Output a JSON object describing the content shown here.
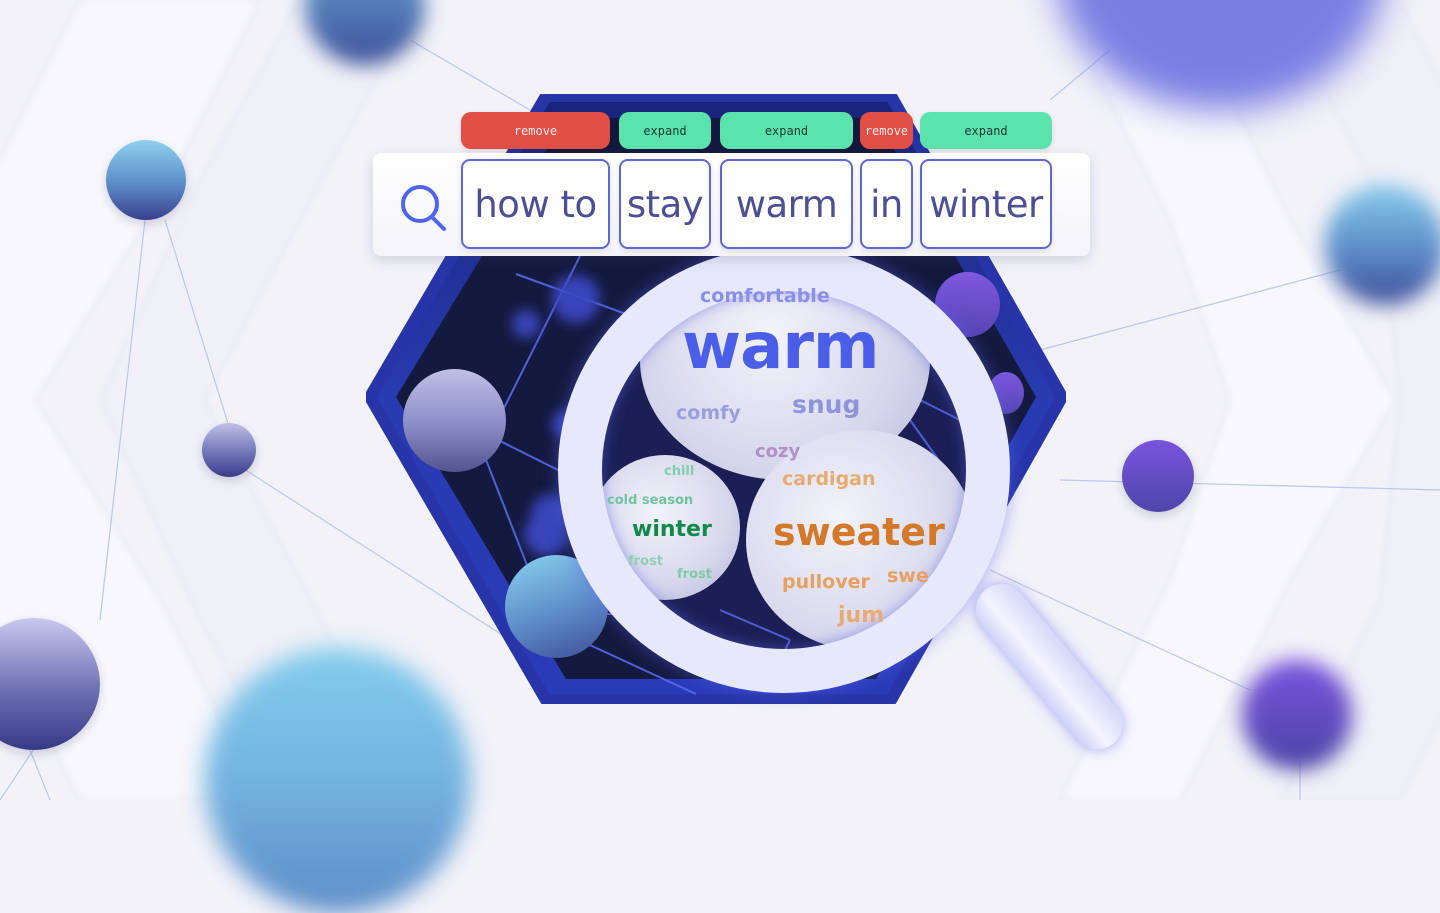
{
  "search": {
    "icon": "search-icon",
    "tokens": [
      {
        "text": "how to",
        "action": "remove"
      },
      {
        "text": "stay",
        "action": "expand"
      },
      {
        "text": "warm",
        "action": "expand"
      },
      {
        "text": "in",
        "action": "remove"
      },
      {
        "text": "winter",
        "action": "expand"
      }
    ]
  },
  "actions": {
    "remove_label": "remove",
    "expand_label": "expand"
  },
  "colors": {
    "remove": "#e14f47",
    "expand": "#5ae3ad",
    "token_border": "#5f68d2",
    "token_text": "#4c4f93",
    "search_icon": "#4f63ef",
    "hexagon": "#2a3bb3",
    "cluster_warm": "#4a5ee8",
    "cluster_winter": "#0f8a4a",
    "cluster_sweater": "#d4782a"
  },
  "magnifier": {
    "clusters": {
      "warm": {
        "main": "warm",
        "related": [
          "comfortable",
          "comfy",
          "snug",
          "cozy"
        ]
      },
      "winter": {
        "main": "winter",
        "related": [
          "chill",
          "cold season",
          "frost",
          "frost"
        ]
      },
      "sweater": {
        "main": "sweater",
        "related": [
          "cardigan",
          "pullover",
          "swe",
          "jum"
        ]
      }
    }
  }
}
